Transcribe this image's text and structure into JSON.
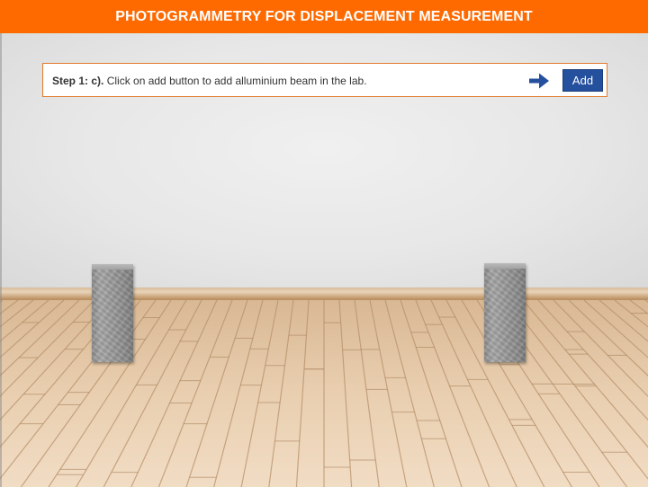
{
  "header": {
    "title": "PHOTOGRAMMETRY FOR DISPLACEMENT MEASUREMENT"
  },
  "instruction": {
    "step_label": "Step 1: c).",
    "text": " Click on add button to add alluminium beam in the lab.",
    "arrow_icon": "arrow-right-icon"
  },
  "actions": {
    "add_label": "Add"
  },
  "colors": {
    "header_bg": "#ff6a00",
    "button_bg": "#24509e",
    "arrow": "#24509e",
    "box_border": "#e07a2e"
  }
}
